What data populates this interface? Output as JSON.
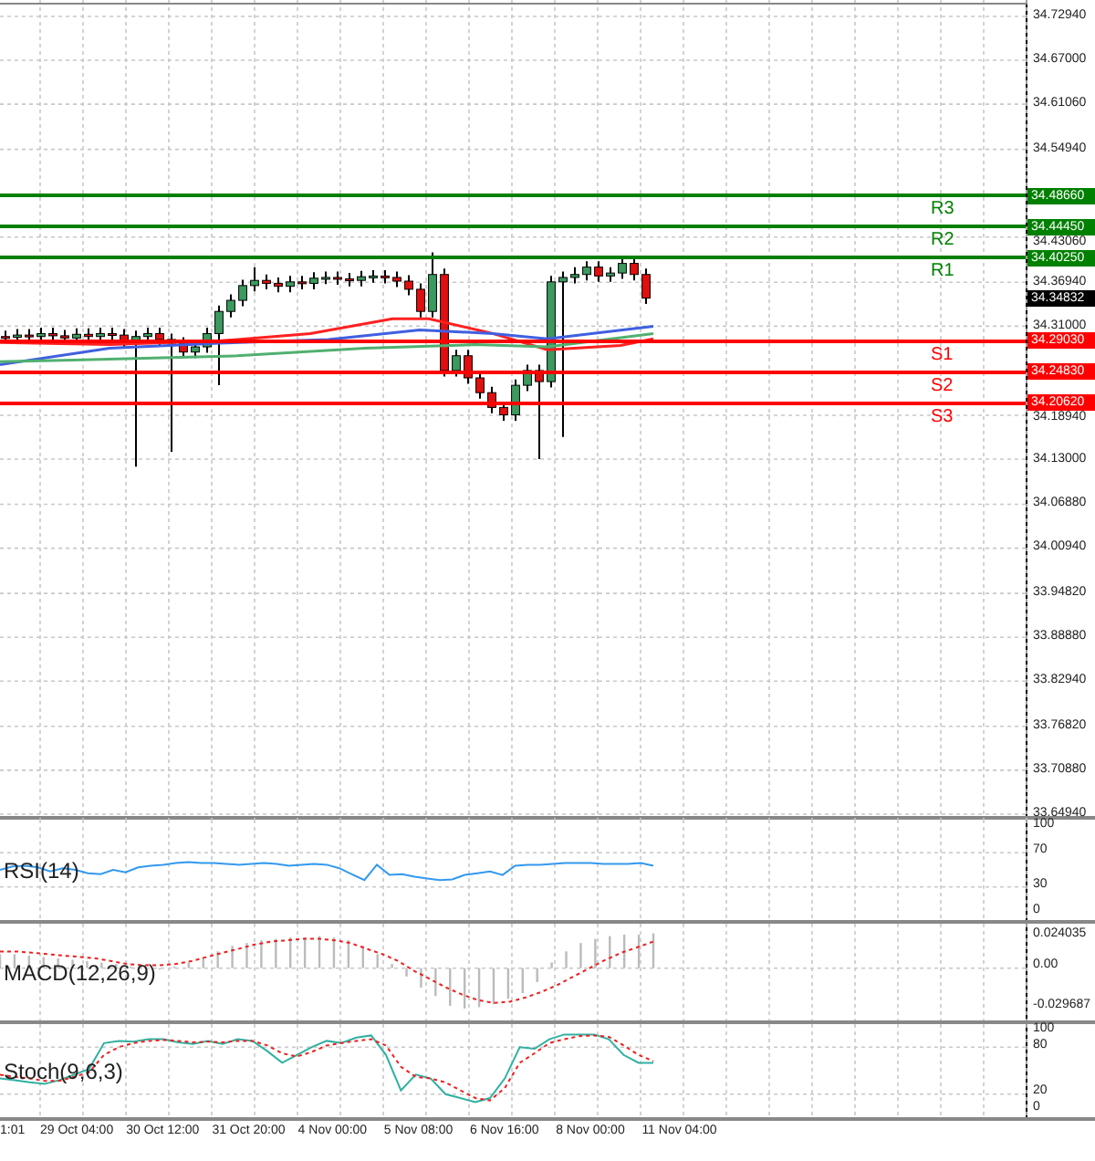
{
  "price_axis": [
    "34.72940",
    "34.67000",
    "34.61060",
    "34.54940",
    "34.43060",
    "34.36940",
    "34.31000",
    "34.18940",
    "34.13000",
    "34.06880",
    "34.00940",
    "33.94820",
    "33.88880",
    "33.82940",
    "33.76820",
    "33.70880",
    "33.64940"
  ],
  "levels": [
    {
      "name": "R3",
      "price": "34.48660",
      "color": "#008000"
    },
    {
      "name": "R2",
      "price": "34.44450",
      "color": "#008000"
    },
    {
      "name": "R1",
      "price": "34.40250",
      "color": "#008000"
    },
    {
      "name": "S1",
      "price": "34.29030",
      "color": "#ff0000"
    },
    {
      "name": "S2",
      "price": "34.24830",
      "color": "#ff0000"
    },
    {
      "name": "S3",
      "price": "34.20620",
      "color": "#ff0000"
    }
  ],
  "current_price": "34.34832",
  "indicators": [
    {
      "kind": "rsi",
      "name": "RSI(14)",
      "axis": [
        "100",
        "70",
        "30",
        "0"
      ]
    },
    {
      "kind": "macd",
      "name": "MACD(12,26,9)",
      "axis": [
        "0.024035",
        "0.00",
        "-0.029687"
      ]
    },
    {
      "kind": "stoch",
      "name": "Stoch(9,6,3)",
      "axis": [
        "100",
        "80",
        "20",
        "0"
      ]
    }
  ],
  "time_axis": [
    "1:01",
    "29 Oct 04:00",
    "30 Oct 12:00",
    "31 Oct 20:00",
    "4 Nov 00:00",
    "5 Nov 08:00",
    "6 Nov 16:00",
    "8 Nov 00:00",
    "11 Nov 04:00"
  ]
}
